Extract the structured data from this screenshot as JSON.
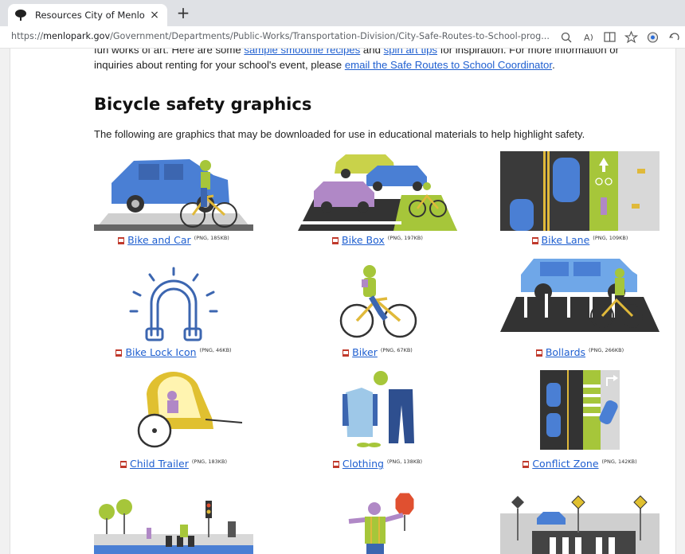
{
  "browser": {
    "tab_title": "Resources City of Menlo Park",
    "tab_close": "×",
    "new_tab": "+",
    "url_prefix": "https://",
    "url_domain": "menlopark.gov",
    "url_path": "/Government/Departments/Public-Works/Transportation-Division/City-Safe-Routes-to-School-prog..."
  },
  "intro": {
    "line1_a": "fun works of art. Here are some ",
    "link_recipes": "sample smoothie recipes",
    "line1_b": " and ",
    "link_tips": "spin art tips",
    "line1_c": " for inspiration. For more information or",
    "line2_a": "inquiries about renting for your school's event, please ",
    "link_email": "email the Safe Routes to School Coordinator",
    "line2_b": "."
  },
  "section": {
    "title": "Bicycle safety graphics",
    "description": "The following are graphics that may be downloaded for use in educational materials to help highlight safety."
  },
  "graphics": [
    {
      "label": "Bike and Car",
      "meta": "(PNG, 185KB)"
    },
    {
      "label": "Bike Box",
      "meta": "(PNG, 197KB)"
    },
    {
      "label": "Bike Lane",
      "meta": "(PNG, 109KB)"
    },
    {
      "label": "Bike Lock Icon",
      "meta": "(PNG, 46KB)"
    },
    {
      "label": "Biker",
      "meta": "(PNG, 67KB)"
    },
    {
      "label": "Bollards",
      "meta": "(PNG, 266KB)"
    },
    {
      "label": "Child Trailer",
      "meta": "(PNG, 183KB)"
    },
    {
      "label": "Clothing",
      "meta": "(PNG, 138KB)"
    },
    {
      "label": "Conflict Zone",
      "meta": "(PNG, 142KB)"
    }
  ],
  "colors": {
    "link": "#1f5fd0",
    "car_blue": "#4a7fd4",
    "lime": "#a6c63a",
    "bike_yellow": "#e0b93a"
  }
}
